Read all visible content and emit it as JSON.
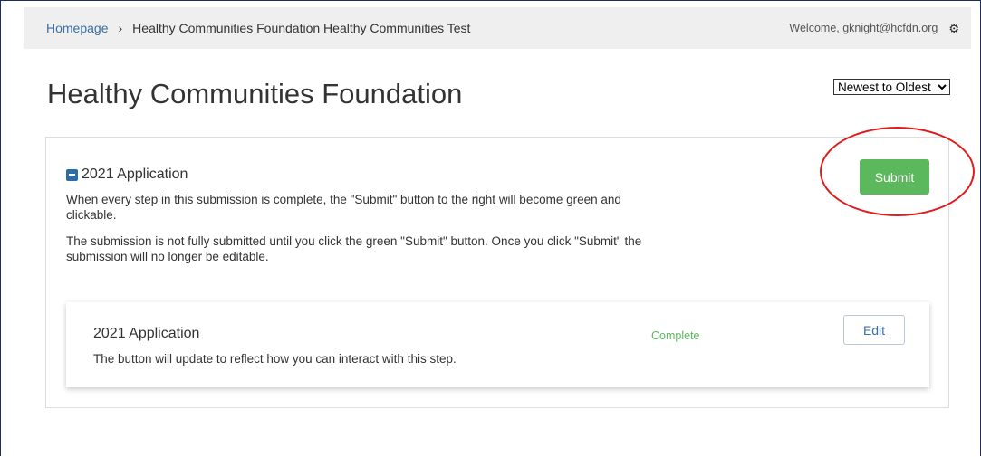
{
  "breadcrumb": {
    "home": "Homepage",
    "separator": "›",
    "current": "Healthy Communities Foundation Healthy Communities Test"
  },
  "user": {
    "welcome": "Welcome, gknight@hcfdn.org",
    "settings_icon": "gear-icon"
  },
  "page": {
    "title": "Healthy Communities Foundation"
  },
  "sort": {
    "selected": "Newest to Oldest",
    "options": [
      "Newest to Oldest"
    ]
  },
  "application": {
    "collapse_icon": "minus-square-icon",
    "title": "2021 Application",
    "description_1": "When every step in this submission is complete, the \"Submit\" button to the right will become green and clickable.",
    "description_2": "The submission is not fully submitted until you click the green \"Submit\" button. Once you click \"Submit\" the submission will no longer be editable.",
    "submit_label": "Submit",
    "accent_color": "#5cb85c"
  },
  "step": {
    "title": "2021 Application",
    "description": "The button will update to reflect how you can interact with this step.",
    "status": "Complete",
    "status_color": "#5cb85c",
    "edit_label": "Edit"
  },
  "annotation": {
    "highlight_color": "#e01b1b"
  }
}
